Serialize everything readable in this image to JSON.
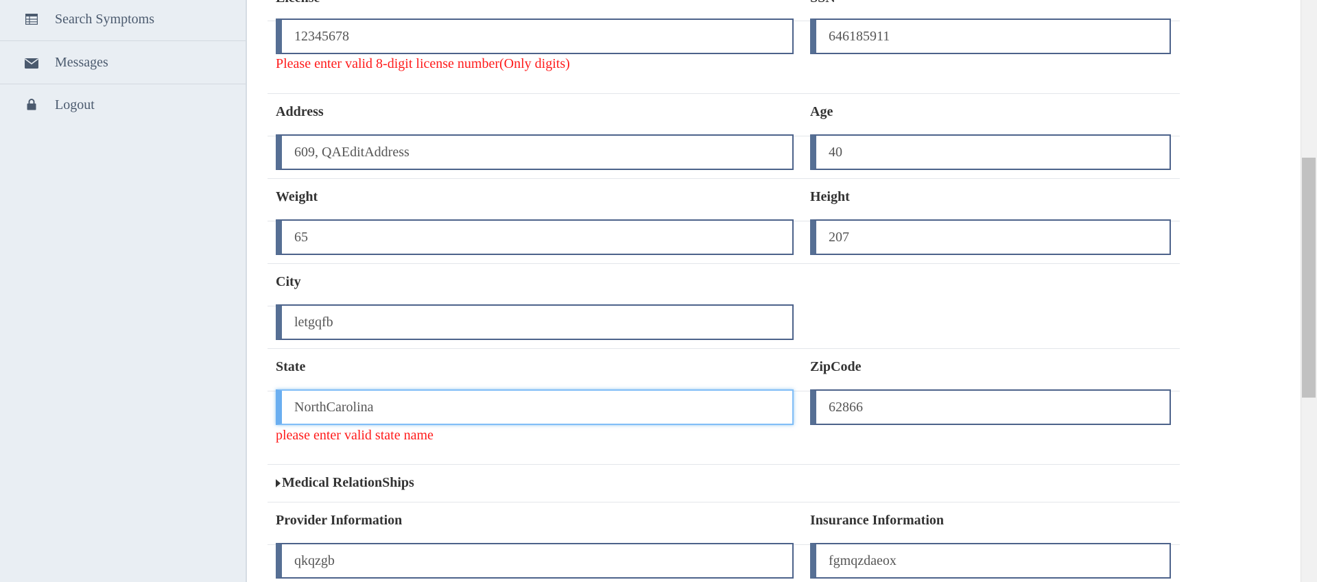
{
  "sidebar": {
    "items": [
      {
        "label": "Search Symptoms",
        "icon": "table-icon"
      },
      {
        "label": "Messages",
        "icon": "envelope-icon"
      },
      {
        "label": "Logout",
        "icon": "lock-icon"
      }
    ]
  },
  "form": {
    "cut_labels": {
      "left": "License",
      "right": "SSN"
    },
    "license": {
      "value": "12345678",
      "error": "Please enter valid 8-digit license number(Only digits)"
    },
    "ssn": {
      "value": "646185911"
    },
    "address": {
      "label": "Address",
      "value": "609, QAEditAddress"
    },
    "age": {
      "label": "Age",
      "value": "40"
    },
    "weight": {
      "label": "Weight",
      "value": "65"
    },
    "height": {
      "label": "Height",
      "value": "207"
    },
    "city": {
      "label": "City",
      "value": "letgqfb"
    },
    "state": {
      "label": "State",
      "value": "NorthCarolina",
      "error": "please enter valid state name"
    },
    "zipcode": {
      "label": "ZipCode",
      "value": "62866"
    },
    "medical_section": {
      "label": "Medical RelationShips"
    },
    "provider": {
      "label": "Provider Information",
      "value": "qkqzgb"
    },
    "insurance": {
      "label": "Insurance Information",
      "value": "fgmqzdaeox"
    }
  },
  "colors": {
    "error": "#ff1a1a",
    "input_border": "#4c628a",
    "input_accent": "#566f94",
    "focus_border": "#80bdf7",
    "sidebar_bg": "#e9eef3"
  }
}
